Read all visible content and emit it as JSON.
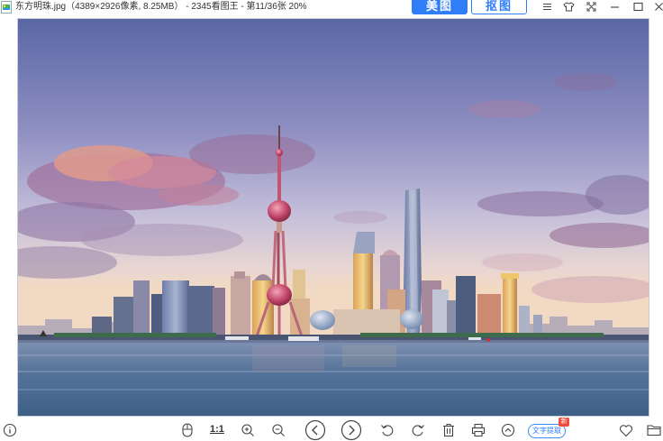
{
  "titlebar": {
    "title": "东方明珠.jpg（4389×2926像素, 8.25MB） - 2345看图王 - 第11/36张 20%",
    "meitu_label": "美图",
    "koutu_label": "抠图",
    "icons": [
      "app-icon",
      "menu-icon",
      "skin-icon",
      "fullscreen-icon",
      "minimize-icon",
      "maximize-icon",
      "close-icon"
    ]
  },
  "image": {
    "subject": "东方明珠",
    "colors": {
      "sky_top": "#5b6aa6",
      "sky_mid": "#b6b3d4",
      "horizon": "#f1d7c6",
      "water": "#4f6e93",
      "tower": "#c24a6a"
    }
  },
  "toolbar": {
    "ratio_label": "1:1",
    "ocr_label": "文字提取",
    "new_badge": "新",
    "icons": [
      "info-icon",
      "mouse-icon",
      "zoom-in-icon",
      "zoom-out-icon",
      "prev-icon",
      "next-icon",
      "rotate-left-icon",
      "rotate-right-icon",
      "delete-icon",
      "print-icon",
      "up-icon",
      "heart-icon",
      "folder-icon"
    ]
  }
}
